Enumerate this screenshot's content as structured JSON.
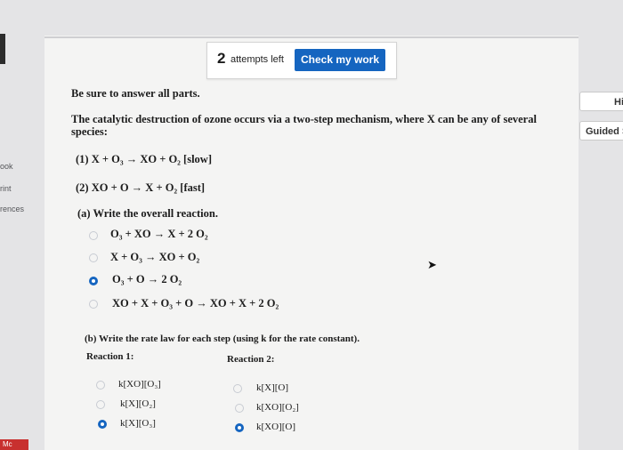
{
  "header": {
    "attempts_number": "2",
    "attempts_label": "attempts left",
    "check_button": "Check my work"
  },
  "left_sidebar": {
    "items": [
      "ook",
      "rint",
      "rences"
    ],
    "logo": "Mc"
  },
  "right_tabs": [
    "Hi",
    "Guided S"
  ],
  "question": {
    "instruction": "Be sure to answer all parts.",
    "intro_line1": "The catalytic destruction of ozone occurs via a two-step mechanism, where X can be any of several",
    "intro_line2": "species:",
    "step1": "(1) X + O₃ → XO + O₂ [slow]",
    "step2": "(2) XO + O → X + O₂ [fast]",
    "part_a": {
      "prompt": "(a) Write the overall reaction.",
      "options": [
        {
          "text": "O₃ + XO → X + 2 O₂",
          "selected": false
        },
        {
          "text": "X + O₃ → XO + O₂",
          "selected": false
        },
        {
          "text": "O₃ + O → 2 O₂",
          "selected": true
        },
        {
          "text": "XO + X + O₃ + O → XO + X + 2 O₂",
          "selected": false
        }
      ]
    },
    "part_b": {
      "prompt": "(b) Write the rate law for each step (using k for the rate constant).",
      "reaction1_label": "Reaction 1:",
      "reaction2_label": "Reaction 2:",
      "reaction1_options": [
        {
          "text": "k[XO][O₃]",
          "selected": false
        },
        {
          "text": "k[X][O₂]",
          "selected": false
        },
        {
          "text": "k[X][O₃]",
          "selected": true
        }
      ],
      "reaction2_options": [
        {
          "text": "k[X][O]",
          "selected": false
        },
        {
          "text": "k[XO][O₂]",
          "selected": false
        },
        {
          "text": "k[XO][O]",
          "selected": true
        }
      ]
    }
  },
  "colors": {
    "accent": "#1565c0",
    "page_bg": "#f4f4f3",
    "outer_bg": "#e4e4e6"
  }
}
